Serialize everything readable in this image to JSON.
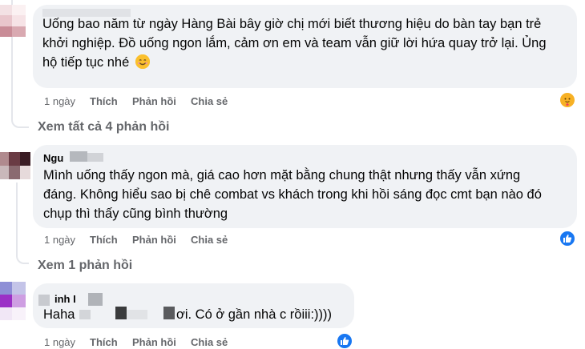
{
  "comments": [
    {
      "author": "",
      "text_line1": "Uống bao năm từ ngày Hàng Bài bây giờ chị mới biết thương hiệu do bàn tay bạn trẻ",
      "text_line2": "khởi nghiệp. Đồ uống ngon lắm, cảm ơn em và team vẫn giữ lời hứa quay trở lại. Ủng",
      "text_line3": "hộ tiếp tục nhé",
      "time": "1 ngày",
      "like_label": "Thích",
      "reply_label": "Phản hồi",
      "share_label": "Chia sẻ",
      "reaction": "hug-reaction",
      "view_replies": "Xem tất cả 4 phản hồi"
    },
    {
      "author": "Ngu",
      "text_line1": "Mình uống thấy ngon mà, giá cao hơn mặt bằng chung thật nhưng thấy vẫn xứng",
      "text_line2": "đáng. Không hiểu sao bị chê combat vs khách trong khi hồi sáng đọc cmt bạn nào đó",
      "text_line3": "chụp thì thấy cũng bình thường",
      "time": "1 ngày",
      "like_label": "Thích",
      "reply_label": "Phản hồi",
      "share_label": "Chia sẻ",
      "reaction": "like-reaction",
      "view_replies": "Xem 1 phản hồi"
    },
    {
      "author": "inh I",
      "text_part1": "Haha",
      "text_part2": "ơi. Có ở gần nhà c rồiii:))))",
      "time": "1 ngày",
      "like_label": "Thích",
      "reply_label": "Phản hồi",
      "share_label": "Chia sẻ",
      "reaction": "like-reaction"
    }
  ],
  "colors": {
    "bubble": "#f0f2f5",
    "muted_text": "#65676b",
    "like_blue": "#1877f2"
  }
}
